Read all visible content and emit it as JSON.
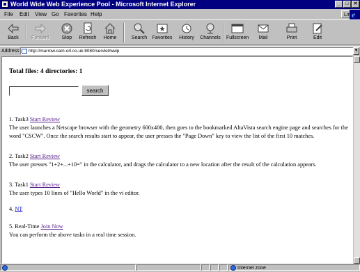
{
  "window": {
    "title": "World Wide Web Experience Pool - Microsoft Internet Explorer",
    "min": "_",
    "max": "□",
    "close": "✕"
  },
  "menu": [
    "File",
    "Edit",
    "View",
    "Go",
    "Favorites",
    "Help"
  ],
  "links_label": "Links",
  "toolbar": [
    {
      "label": "Back",
      "icon": "back-arrow-icon",
      "enabled": true
    },
    {
      "label": "Forward",
      "icon": "forward-arrow-icon",
      "enabled": false
    },
    {
      "label": "Stop",
      "icon": "stop-icon",
      "enabled": true
    },
    {
      "label": "Refresh",
      "icon": "refresh-icon",
      "enabled": true
    },
    {
      "label": "Home",
      "icon": "home-icon",
      "enabled": true
    },
    {
      "label": "Search",
      "icon": "search-icon",
      "enabled": true
    },
    {
      "label": "Favorites",
      "icon": "favorites-icon",
      "enabled": true
    },
    {
      "label": "History",
      "icon": "history-icon",
      "enabled": true
    },
    {
      "label": "Channels",
      "icon": "channels-icon",
      "enabled": true
    },
    {
      "label": "Fullscreen",
      "icon": "fullscreen-icon",
      "enabled": true
    },
    {
      "label": "Mail",
      "icon": "mail-icon",
      "enabled": true
    },
    {
      "label": "Print",
      "icon": "print-icon",
      "enabled": true
    },
    {
      "label": "Edit",
      "icon": "edit-icon",
      "enabled": true
    }
  ],
  "address": {
    "label": "Address",
    "url": "http://marrow.cam-orl.co.uk:8080/servlet/wwp"
  },
  "page": {
    "total": "Total files: 4 directories: 1",
    "search_button": "search",
    "search_value": "",
    "items": [
      {
        "prefix": "1. Task3",
        "link": "Start Review",
        "text": "The user launches a Netscape browser with the geometry 600x400, then goes to the bookmarked AltaVista search engine page and searches for the word \"CSCW\". Once the search results start to appear, the user presses the \"Page Down\" key to view the list of the first 10 matches."
      },
      {
        "prefix": "2. Task2",
        "link": "Start Review",
        "text": "The user presses \"1+2+...+10=\" in the calculator, and drags the calculator to a new location after the result of the calculation appears."
      },
      {
        "prefix": "3. Task1",
        "link": "Start Review",
        "text": "The user types 10 lines of \"Hello World\" in the vi editor."
      },
      {
        "prefix": "4.",
        "link": "NT",
        "text": ""
      },
      {
        "prefix": "5. Real-Time",
        "link": "Join Now",
        "text": "You can perform the above tasks in a real time session."
      }
    ]
  },
  "status": {
    "zone": "Internet zone"
  }
}
